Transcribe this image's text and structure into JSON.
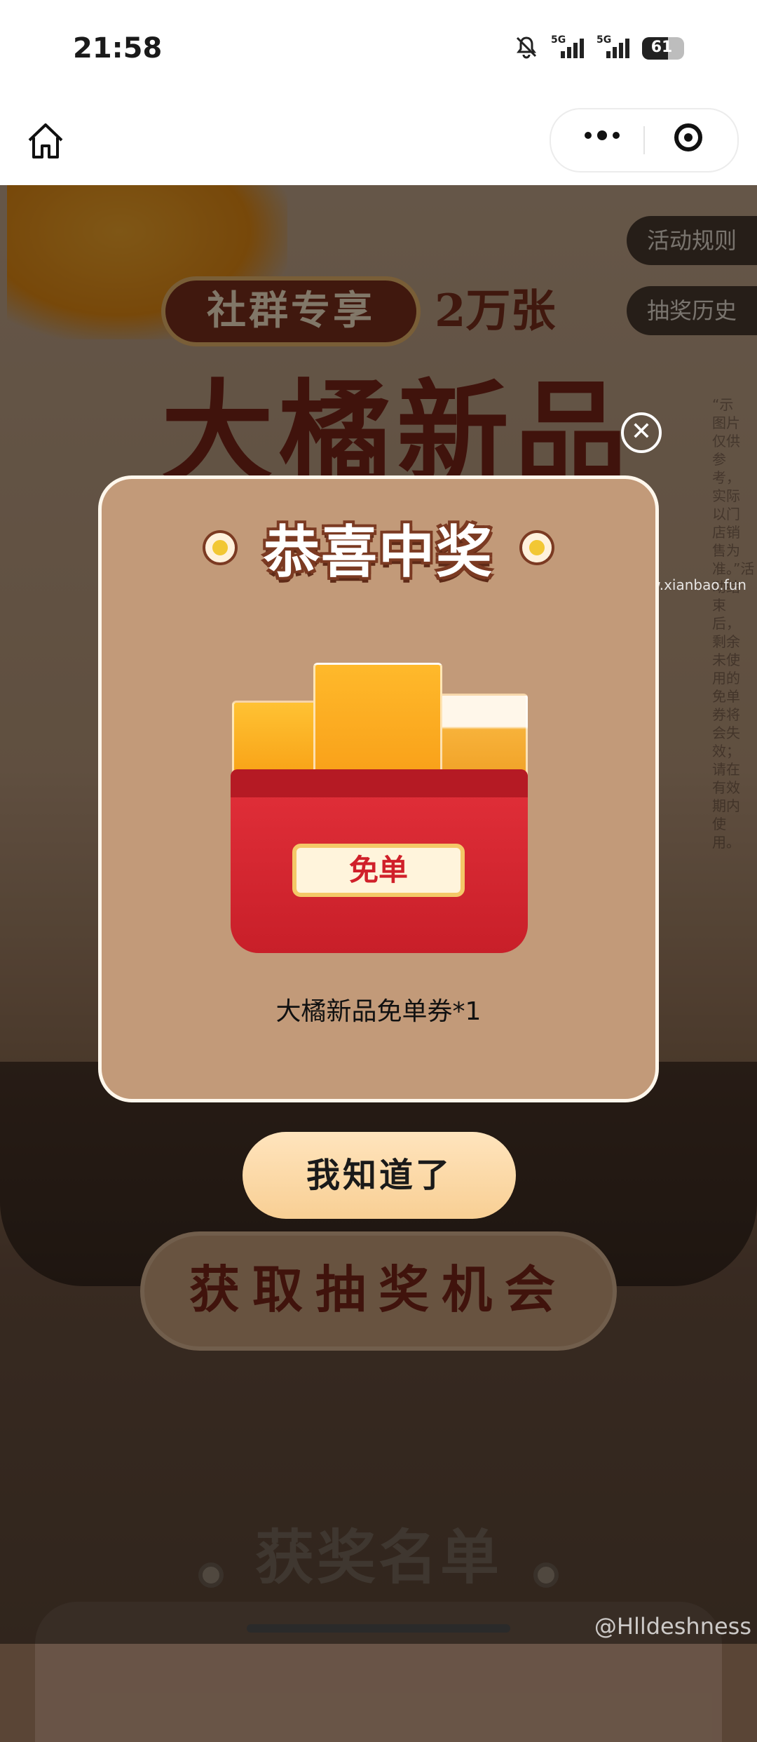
{
  "status_bar": {
    "time": "21:58",
    "signal1_label": "5G",
    "signal2_label": "5G",
    "battery": "61",
    "battery_level": 0.61
  },
  "nav": {
    "home_icon": "home-icon",
    "more_icon": "more-dots-icon",
    "close_mini_icon": "target-icon"
  },
  "page": {
    "rules_label": "活动规则",
    "history_label": "抽奖历史",
    "banner_pill": "社群专享",
    "banner_count": "2万张",
    "title": "大橘新品",
    "side_text": "“示图片仅供参考，实际以门店销售为准。”活动结束后，剩余未使用的免单券将会失效；请在有效期内使用。",
    "watermark": "线报酷-new.xianbao.fun",
    "cta_label": "获取抽奖机会",
    "winners_title": "获奖名单"
  },
  "modal": {
    "close_icon": "close-icon",
    "heading": "恭喜中奖",
    "tag_label": "免单",
    "prize_name": "大橘新品免单券*1",
    "ok_label": "我知道了"
  },
  "footer": {
    "credit": "@Hlldeshness"
  }
}
